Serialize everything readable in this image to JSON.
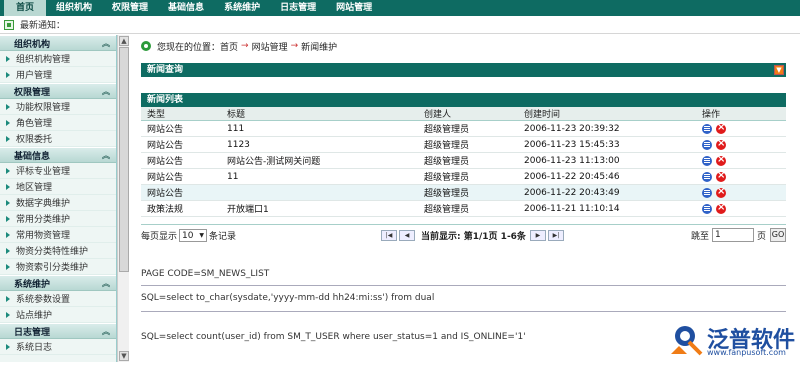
{
  "topnav": {
    "tabs": [
      "首页",
      "组织机构",
      "权限管理",
      "基础信息",
      "系统维护",
      "日志管理",
      "网站管理"
    ]
  },
  "notice": {
    "label": "最新通知："
  },
  "sidebar": {
    "groups": [
      {
        "title": "组织机构",
        "items": [
          "组织机构管理",
          "用户管理"
        ]
      },
      {
        "title": "权限管理",
        "items": [
          "功能权限管理",
          "角色管理",
          "权限委托"
        ]
      },
      {
        "title": "基础信息",
        "items": [
          "评标专业管理",
          "地区管理",
          "数据字典维护",
          "常用分类维护",
          "常用物资管理",
          "物资分类特性维护",
          "物资索引分类维护"
        ]
      },
      {
        "title": "系统维护",
        "items": [
          "系统参数设置",
          "站点维护"
        ]
      },
      {
        "title": "日志管理",
        "items": [
          "系统日志"
        ]
      }
    ]
  },
  "breadcrumb": {
    "label": "您现在的位置：",
    "path": [
      "首页",
      "网站管理",
      "新闻维护"
    ]
  },
  "search_panel": {
    "title": "新闻查询"
  },
  "list_panel": {
    "title": "新闻列表"
  },
  "table": {
    "headers": [
      "类型",
      "标题",
      "创建人",
      "创建时间",
      "操作"
    ],
    "rows": [
      {
        "type": "网站公告",
        "title": "111",
        "creator": "超级管理员",
        "time": "2006-11-23 20:39:32"
      },
      {
        "type": "网站公告",
        "title": "1123",
        "creator": "超级管理员",
        "time": "2006-11-23 15:45:33"
      },
      {
        "type": "网站公告",
        "title": "网站公告-测试网关问题",
        "creator": "超级管理员",
        "time": "2006-11-23 11:13:00"
      },
      {
        "type": "网站公告",
        "title": "11",
        "creator": "超级管理员",
        "time": "2006-11-22 20:45:46"
      },
      {
        "type": "网站公告",
        "title": "",
        "creator": "超级管理员",
        "time": "2006-11-22 20:43:49"
      },
      {
        "type": "政策法规",
        "title": "开放端口1",
        "creator": "超级管理员",
        "time": "2006-11-21 11:10:14"
      }
    ]
  },
  "pager": {
    "per_page_label": "每页显示",
    "per_page_value": "10",
    "records_label": "条记录",
    "status": "当前显示: 第1/1页 1-6条",
    "jump_label": "跳至",
    "jump_value": "1",
    "page_label": "页",
    "go_label": "GO"
  },
  "debug": {
    "page_code": "PAGE CODE=SM_NEWS_LIST",
    "sql1": "SQL=select to_char(sysdate,'yyyy-mm-dd hh24:mi:ss') from dual",
    "sql2": "SQL=select count(user_id) from SM_T_USER where user_status=1 and IS_ONLINE='1'"
  },
  "logo": {
    "name": "泛普软件",
    "url": "www.fanpusoft.com"
  },
  "colors": {
    "theme": "#0e6b62",
    "accent": "#f07c16"
  }
}
